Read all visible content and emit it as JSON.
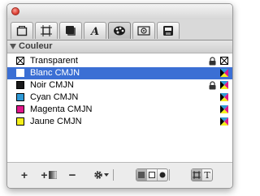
{
  "panel": {
    "section_title": "Couleur",
    "tabs": [
      "frame-tab",
      "box-tab",
      "shadow-tab",
      "text-tab",
      "color-tab",
      "image-tab",
      "export-tab"
    ]
  },
  "swatches": [
    {
      "label": "Transparent",
      "color": "none",
      "locked": true,
      "selected": false
    },
    {
      "label": "Blanc CMJN",
      "color": "#ffffff",
      "locked": false,
      "selected": true
    },
    {
      "label": "Noir CMJN",
      "color": "#1a1a1a",
      "locked": true,
      "selected": false
    },
    {
      "label": "Cyan CMJN",
      "color": "#2f9ad6",
      "locked": false,
      "selected": false
    },
    {
      "label": "Magenta CMJN",
      "color": "#e0168a",
      "locked": false,
      "selected": false
    },
    {
      "label": "Jaune CMJN",
      "color": "#f5ef1a",
      "locked": false,
      "selected": false
    }
  ],
  "footer": {
    "add_label": "+",
    "add_gradient_label": "+",
    "delete_label": "−",
    "text_toggle_label": "T"
  }
}
